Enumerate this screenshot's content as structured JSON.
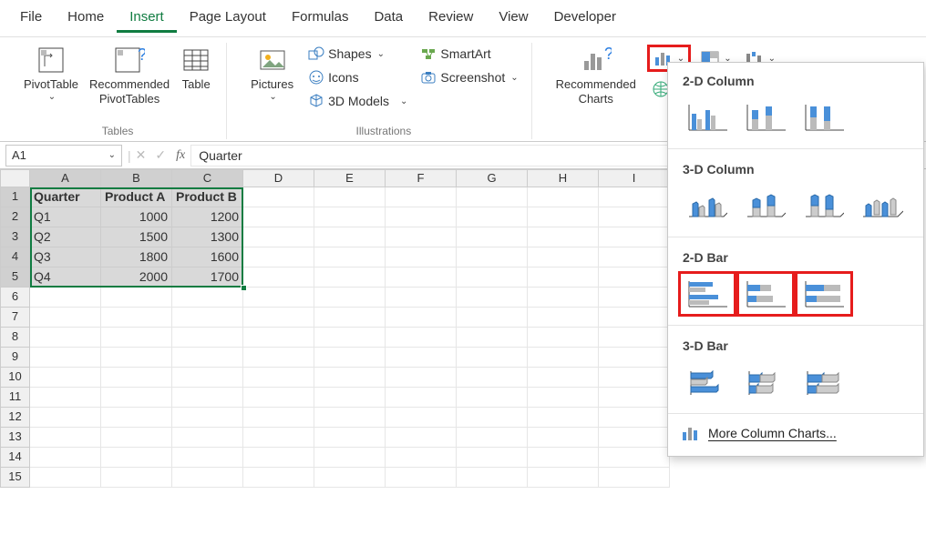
{
  "menu": {
    "items": [
      "File",
      "Home",
      "Insert",
      "Page Layout",
      "Formulas",
      "Data",
      "Review",
      "View",
      "Developer"
    ],
    "active": "Insert"
  },
  "ribbon": {
    "tables": {
      "pivot": "PivotTable",
      "recommended_pivot": "Recommended\nPivotTables",
      "table": "Table",
      "group": "Tables"
    },
    "illustrations": {
      "pictures": "Pictures",
      "shapes": "Shapes",
      "icons": "Icons",
      "models": "3D Models",
      "smartart": "SmartArt",
      "screenshot": "Screenshot",
      "group": "Illustrations"
    },
    "charts": {
      "recommended": "Recommended\nCharts"
    }
  },
  "fbar": {
    "name": "A1",
    "value": "Quarter"
  },
  "grid": {
    "cols": [
      "A",
      "B",
      "C",
      "D",
      "E",
      "F",
      "G",
      "H",
      "I"
    ],
    "rows": [
      [
        "Quarter",
        "Product A",
        "Product B",
        "",
        "",
        "",
        "",
        "",
        ""
      ],
      [
        "Q1",
        "1000",
        "1200",
        "",
        "",
        "",
        "",
        "",
        ""
      ],
      [
        "Q2",
        "1500",
        "1300",
        "",
        "",
        "",
        "",
        "",
        ""
      ],
      [
        "Q3",
        "1800",
        "1600",
        "",
        "",
        "",
        "",
        "",
        ""
      ],
      [
        "Q4",
        "2000",
        "1700",
        "",
        "",
        "",
        "",
        "",
        ""
      ],
      [
        "",
        "",
        "",
        "",
        "",
        "",
        "",
        "",
        ""
      ],
      [
        "",
        "",
        "",
        "",
        "",
        "",
        "",
        "",
        ""
      ],
      [
        "",
        "",
        "",
        "",
        "",
        "",
        "",
        "",
        ""
      ],
      [
        "",
        "",
        "",
        "",
        "",
        "",
        "",
        "",
        ""
      ],
      [
        "",
        "",
        "",
        "",
        "",
        "",
        "",
        "",
        ""
      ],
      [
        "",
        "",
        "",
        "",
        "",
        "",
        "",
        "",
        ""
      ],
      [
        "",
        "",
        "",
        "",
        "",
        "",
        "",
        "",
        ""
      ],
      [
        "",
        "",
        "",
        "",
        "",
        "",
        "",
        "",
        ""
      ],
      [
        "",
        "",
        "",
        "",
        "",
        "",
        "",
        "",
        ""
      ],
      [
        "",
        "",
        "",
        "",
        "",
        "",
        "",
        "",
        ""
      ]
    ],
    "selected_cols": 3,
    "selected_rows": 5
  },
  "dropdown": {
    "s1": "2-D Column",
    "s2": "3-D Column",
    "s3": "2-D Bar",
    "s4": "3-D Bar",
    "more": "More Column Charts..."
  },
  "chart_data": {
    "type": "bar",
    "categories": [
      "Q1",
      "Q2",
      "Q3",
      "Q4"
    ],
    "series": [
      {
        "name": "Product A",
        "values": [
          1000,
          1500,
          1800,
          2000
        ]
      },
      {
        "name": "Product B",
        "values": [
          1200,
          1300,
          1600,
          1700
        ]
      }
    ],
    "title": "",
    "xlabel": "",
    "ylabel": "",
    "ylim": [
      0,
      2000
    ]
  }
}
